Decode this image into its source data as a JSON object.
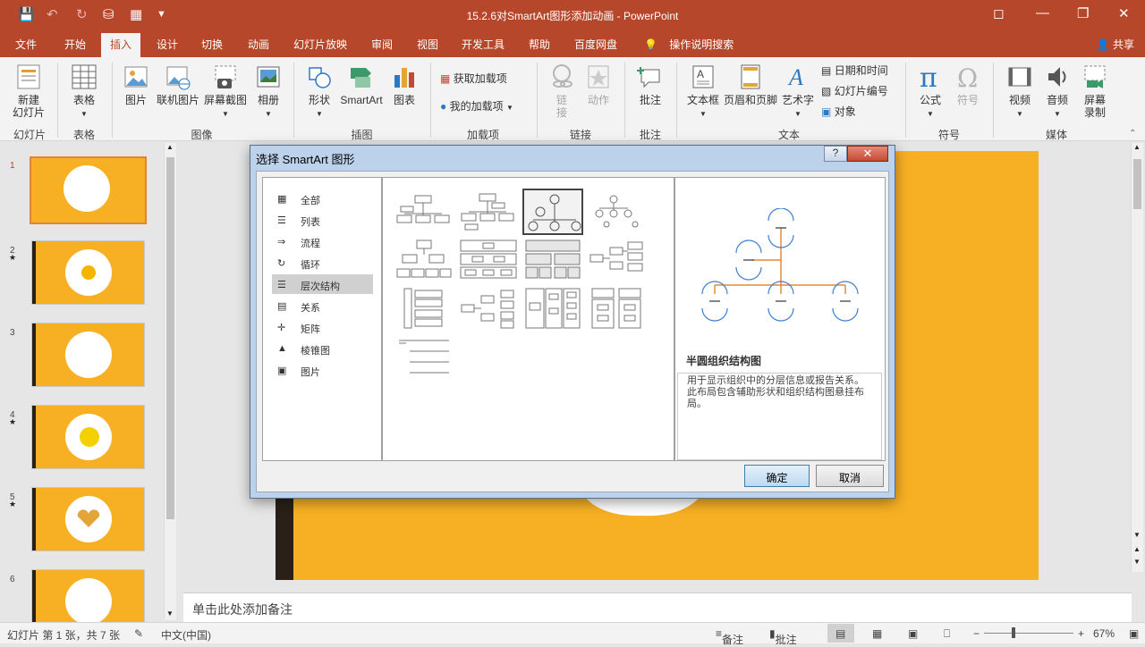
{
  "window": {
    "title": "15.2.6对SmartArt图形添加动画  -  PowerPoint",
    "restore_icon": "ribbon-display-icon"
  },
  "tabs": [
    "文件",
    "开始",
    "插入",
    "设计",
    "切换",
    "动画",
    "幻灯片放映",
    "审阅",
    "视图",
    "开发工具",
    "帮助",
    "百度网盘"
  ],
  "active_tab": "插入",
  "tell_me": "操作说明搜索",
  "share": "共享",
  "ribbon": {
    "new_slide": "新建\n幻灯片",
    "table": "表格",
    "picture": "图片",
    "online_picture": "联机图片",
    "screenshot": "屏幕截图",
    "album": "相册",
    "shapes": "形状",
    "smartart": "SmartArt",
    "chart": "图表",
    "get_addins": "获取加载项",
    "my_addins": "我的加载项",
    "link": "链\n接",
    "action": "动作",
    "comment": "批注",
    "textbox": "文本框",
    "header_footer": "页眉和页脚",
    "wordart": "艺术字",
    "date_time": "日期和时间",
    "slide_number": "幻灯片编号",
    "object": "对象",
    "equation": "公式",
    "symbol": "符号",
    "video": "视频",
    "audio": "音频",
    "screen_record": "屏幕\n录制",
    "groups": {
      "slides": "幻灯片",
      "tables": "表格",
      "images": "图像",
      "illustrations": "插图",
      "addins": "加载项",
      "links": "链接",
      "comments": "批注",
      "text": "文本",
      "symbols": "符号",
      "media": "媒体"
    }
  },
  "slides": [
    {
      "num": "1"
    },
    {
      "num": "2"
    },
    {
      "num": "3"
    },
    {
      "num": "4"
    },
    {
      "num": "5"
    },
    {
      "num": "6"
    }
  ],
  "notes_placeholder": "单击此处添加备注",
  "status": {
    "slide_info": "幻灯片 第 1 张，共 7 张",
    "language": "中文(中国)",
    "notes": "备注",
    "comments": "批注",
    "zoom": "67%"
  },
  "dialog": {
    "title": "选择 SmartArt 图形",
    "help": "?",
    "categories": [
      "全部",
      "列表",
      "流程",
      "循环",
      "层次结构",
      "关系",
      "矩阵",
      "棱锥图",
      "图片"
    ],
    "selected_category": "层次结构",
    "preview_name": "半圆组织结构图",
    "preview_desc": "用于显示组织中的分层信息或报告关系。此布局包含辅助形状和组织结构图悬挂布局。",
    "ok": "确定",
    "cancel": "取消"
  },
  "colors": {
    "accent": "#b7472a",
    "slide_bg": "#f7b023"
  }
}
